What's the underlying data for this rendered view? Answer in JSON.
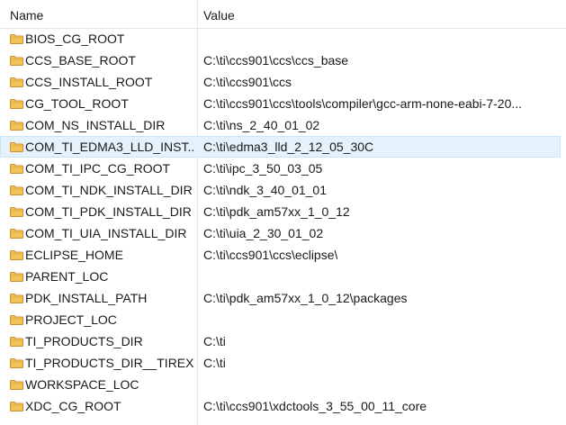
{
  "columns": {
    "name": "Name",
    "value": "Value"
  },
  "rows": [
    {
      "name": "BIOS_CG_ROOT",
      "value": ""
    },
    {
      "name": "CCS_BASE_ROOT",
      "value": "C:\\ti\\ccs901\\ccs\\ccs_base"
    },
    {
      "name": "CCS_INSTALL_ROOT",
      "value": "C:\\ti\\ccs901\\ccs"
    },
    {
      "name": "CG_TOOL_ROOT",
      "value": "C:\\ti\\ccs901\\ccs\\tools\\compiler\\gcc-arm-none-eabi-7-20..."
    },
    {
      "name": "COM_NS_INSTALL_DIR",
      "value": "C:\\ti\\ns_2_40_01_02"
    },
    {
      "name": "COM_TI_EDMA3_LLD_INST...",
      "value": "C:\\ti\\edma3_lld_2_12_05_30C",
      "selected": true
    },
    {
      "name": "COM_TI_IPC_CG_ROOT",
      "value": "C:\\ti\\ipc_3_50_03_05"
    },
    {
      "name": "COM_TI_NDK_INSTALL_DIR",
      "value": "C:\\ti\\ndk_3_40_01_01"
    },
    {
      "name": "COM_TI_PDK_INSTALL_DIR",
      "value": "C:\\ti\\pdk_am57xx_1_0_12"
    },
    {
      "name": "COM_TI_UIA_INSTALL_DIR",
      "value": "C:\\ti\\uia_2_30_01_02"
    },
    {
      "name": "ECLIPSE_HOME",
      "value": "C:\\ti\\ccs901\\ccs\\eclipse\\"
    },
    {
      "name": "PARENT_LOC",
      "value": ""
    },
    {
      "name": "PDK_INSTALL_PATH",
      "value": "C:\\ti\\pdk_am57xx_1_0_12\\packages"
    },
    {
      "name": "PROJECT_LOC",
      "value": ""
    },
    {
      "name": "TI_PRODUCTS_DIR",
      "value": "C:\\ti"
    },
    {
      "name": "TI_PRODUCTS_DIR__TIREX",
      "value": "C:\\ti"
    },
    {
      "name": "WORKSPACE_LOC",
      "value": ""
    },
    {
      "name": "XDC_CG_ROOT",
      "value": "C:\\ti\\ccs901\\xdctools_3_55_00_11_core"
    }
  ],
  "icons": {
    "row_icon": "folder-icon"
  },
  "colors": {
    "folder": "#e8a838",
    "selection": "#e5f1fb"
  }
}
